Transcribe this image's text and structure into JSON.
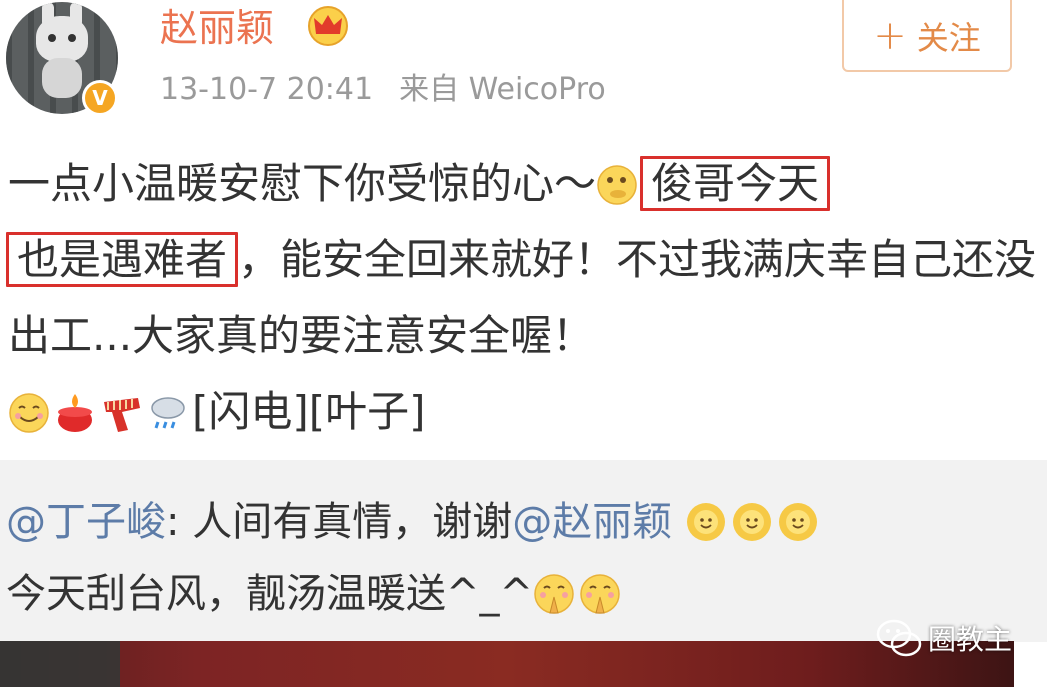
{
  "user": {
    "name": "赵丽颖",
    "time": "13-10-7 20:41",
    "source": "来自 WeicoPro",
    "verified_badge": "V"
  },
  "follow_button": {
    "plus": "+",
    "label": "关注"
  },
  "post": {
    "line1_text": "一点小温暖安慰下你受惊的心～",
    "highlight1": "俊哥今天",
    "highlight2": "也是遇难者",
    "rest": "，能安全回来就好！不过我满庆幸自己还没出工...大家真的要注意安全喔！",
    "tags": "[闪电][叶子]"
  },
  "repost": {
    "mention_user": "@丁子峻",
    "text1": ": 人间有真情，谢谢",
    "mention_target": "@赵丽颖",
    "text2": "今天刮台风，靓汤温暖送^_^"
  },
  "watermark": {
    "label": "圈教主"
  },
  "colors": {
    "username": "#eb7350",
    "follow": "#e38a48",
    "meta": "#9a9a9a",
    "mention": "#5d7ca8",
    "highlight_border": "#d9302c",
    "repost_bg": "#f2f2f2"
  },
  "icons": [
    "avatar",
    "verified-badge-icon",
    "crown-icon",
    "plus-icon",
    "smile-emoji",
    "candle-emoji",
    "scarf-emoji",
    "rain-cloud-emoji",
    "sun-flower-emoji",
    "pray-emoji",
    "wechat-icon"
  ]
}
